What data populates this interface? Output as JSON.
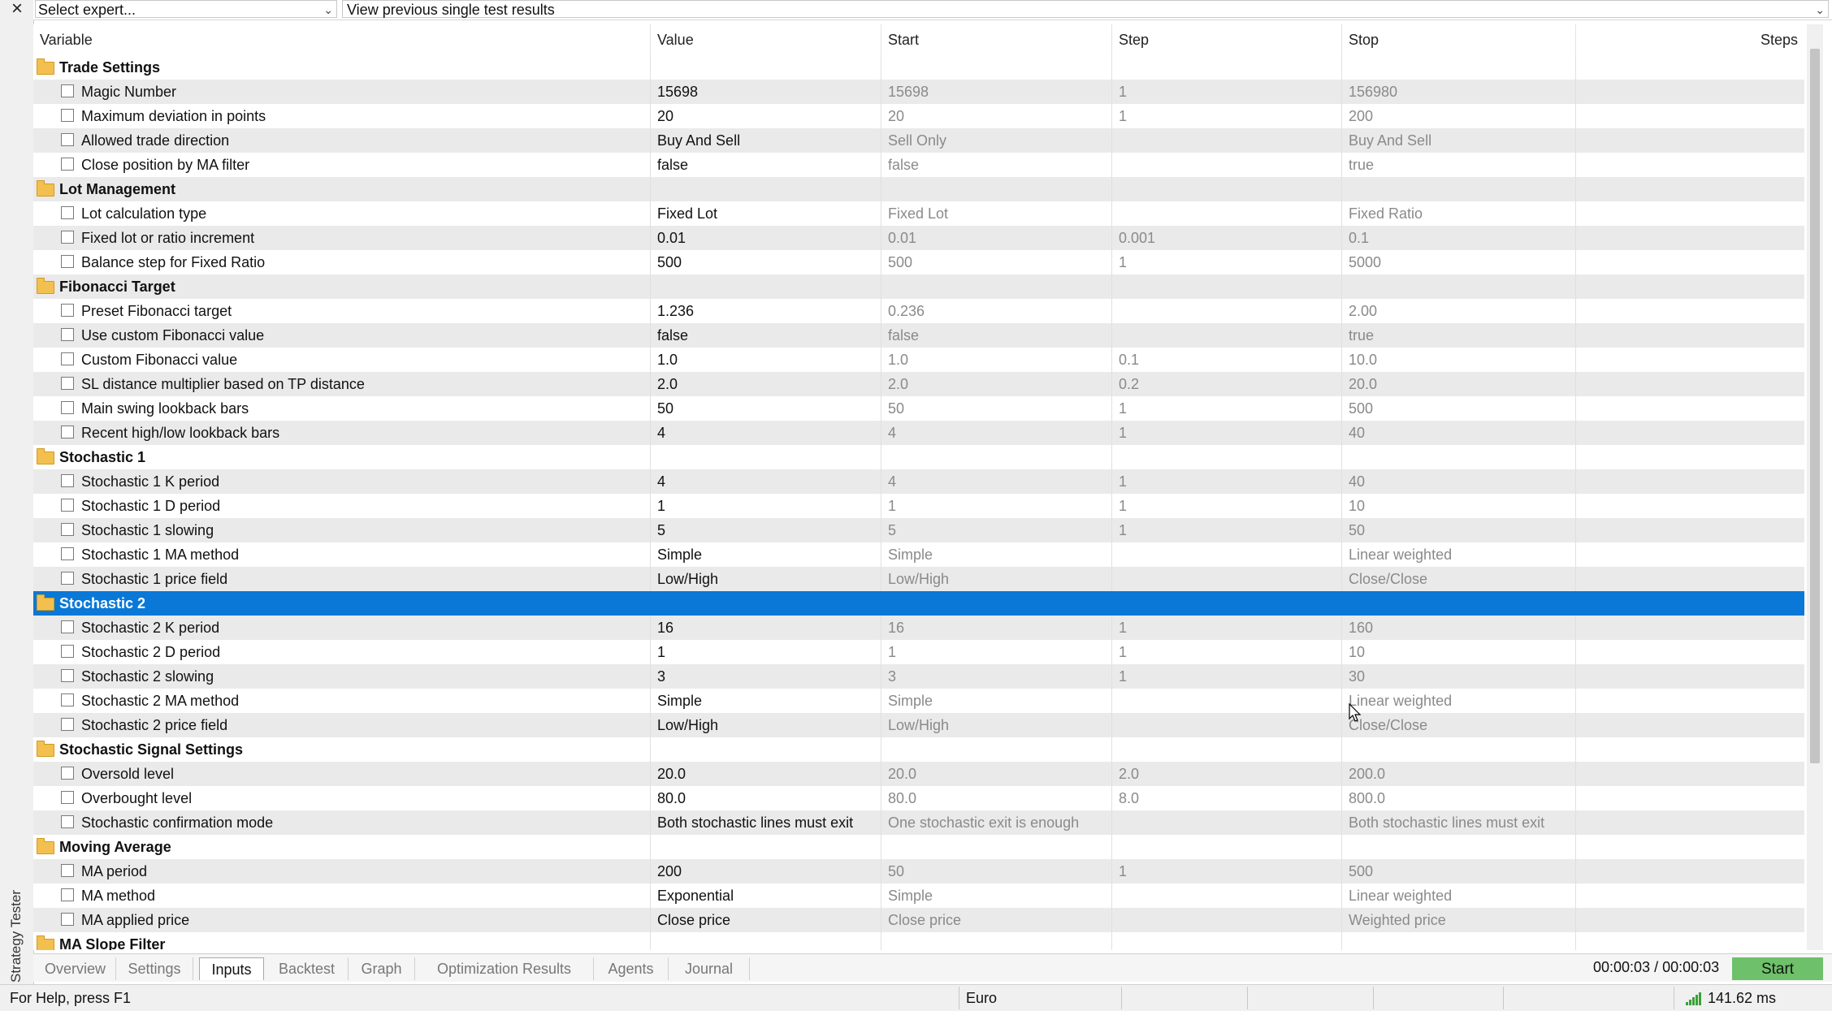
{
  "top": {
    "close_icon": "×",
    "expert_select": "Select expert...",
    "view_previous": "View previous single test results",
    "chevron": "⌄"
  },
  "side": {
    "label": "Strategy Tester"
  },
  "header": {
    "variable": "Variable",
    "value": "Value",
    "start": "Start",
    "step": "Step",
    "stop": "Stop",
    "steps": "Steps"
  },
  "rows": [
    {
      "type": "group",
      "name": "Trade Settings"
    },
    {
      "type": "param",
      "name": "Magic Number",
      "value": "15698",
      "start": "15698",
      "step": "1",
      "stop": "156980"
    },
    {
      "type": "param",
      "name": "Maximum deviation in points",
      "value": "20",
      "start": "20",
      "step": "1",
      "stop": "200"
    },
    {
      "type": "param",
      "name": "Allowed trade direction",
      "value": "Buy And Sell",
      "start": "Sell Only",
      "step": "",
      "stop": "Buy And Sell"
    },
    {
      "type": "param",
      "name": "Close position by MA filter",
      "value": "false",
      "start": "false",
      "step": "",
      "stop": "true"
    },
    {
      "type": "group",
      "name": "Lot Management"
    },
    {
      "type": "param",
      "name": "Lot calculation type",
      "value": "Fixed Lot",
      "start": "Fixed Lot",
      "step": "",
      "stop": "Fixed Ratio"
    },
    {
      "type": "param",
      "name": "Fixed lot or ratio increment",
      "value": "0.01",
      "start": "0.01",
      "step": "0.001",
      "stop": "0.1"
    },
    {
      "type": "param",
      "name": "Balance step for Fixed Ratio",
      "value": "500",
      "start": "500",
      "step": "1",
      "stop": "5000"
    },
    {
      "type": "group",
      "name": "Fibonacci Target"
    },
    {
      "type": "param",
      "name": "Preset Fibonacci target",
      "value": "1.236",
      "start": "0.236",
      "step": "",
      "stop": "2.00"
    },
    {
      "type": "param",
      "name": "Use custom Fibonacci value",
      "value": "false",
      "start": "false",
      "step": "",
      "stop": "true"
    },
    {
      "type": "param",
      "name": "Custom Fibonacci value",
      "value": "1.0",
      "start": "1.0",
      "step": "0.1",
      "stop": "10.0"
    },
    {
      "type": "param",
      "name": "SL distance multiplier based on TP distance",
      "value": "2.0",
      "start": "2.0",
      "step": "0.2",
      "stop": "20.0"
    },
    {
      "type": "param",
      "name": "Main swing lookback bars",
      "value": "50",
      "start": "50",
      "step": "1",
      "stop": "500"
    },
    {
      "type": "param",
      "name": "Recent high/low lookback bars",
      "value": "4",
      "start": "4",
      "step": "1",
      "stop": "40"
    },
    {
      "type": "group",
      "name": "Stochastic 1"
    },
    {
      "type": "param",
      "name": "Stochastic 1 K period",
      "value": "4",
      "start": "4",
      "step": "1",
      "stop": "40"
    },
    {
      "type": "param",
      "name": "Stochastic 1 D period",
      "value": "1",
      "start": "1",
      "step": "1",
      "stop": "10"
    },
    {
      "type": "param",
      "name": "Stochastic 1 slowing",
      "value": "5",
      "start": "5",
      "step": "1",
      "stop": "50"
    },
    {
      "type": "param",
      "name": "Stochastic 1 MA method",
      "value": "Simple",
      "start": "Simple",
      "step": "",
      "stop": "Linear weighted"
    },
    {
      "type": "param",
      "name": "Stochastic 1 price field",
      "value": "Low/High",
      "start": "Low/High",
      "step": "",
      "stop": "Close/Close"
    },
    {
      "type": "group",
      "name": "Stochastic 2",
      "selected": true
    },
    {
      "type": "param",
      "name": "Stochastic 2 K period",
      "value": "16",
      "start": "16",
      "step": "1",
      "stop": "160"
    },
    {
      "type": "param",
      "name": "Stochastic 2 D period",
      "value": "1",
      "start": "1",
      "step": "1",
      "stop": "10"
    },
    {
      "type": "param",
      "name": "Stochastic 2 slowing",
      "value": "3",
      "start": "3",
      "step": "1",
      "stop": "30"
    },
    {
      "type": "param",
      "name": "Stochastic 2 MA method",
      "value": "Simple",
      "start": "Simple",
      "step": "",
      "stop": "Linear weighted"
    },
    {
      "type": "param",
      "name": "Stochastic 2 price field",
      "value": "Low/High",
      "start": "Low/High",
      "step": "",
      "stop": "Close/Close"
    },
    {
      "type": "group",
      "name": "Stochastic Signal Settings"
    },
    {
      "type": "param",
      "name": "Oversold level",
      "value": "20.0",
      "start": "20.0",
      "step": "2.0",
      "stop": "200.0"
    },
    {
      "type": "param",
      "name": "Overbought level",
      "value": "80.0",
      "start": "80.0",
      "step": "8.0",
      "stop": "800.0"
    },
    {
      "type": "param",
      "name": "Stochastic confirmation mode",
      "value": "Both stochastic lines must exit",
      "start": "One stochastic exit is enough",
      "step": "",
      "stop": "Both stochastic lines must exit"
    },
    {
      "type": "group",
      "name": "Moving Average"
    },
    {
      "type": "param",
      "name": "MA period",
      "value": "200",
      "start": "50",
      "step": "1",
      "stop": "500"
    },
    {
      "type": "param",
      "name": "MA method",
      "value": "Exponential",
      "start": "Simple",
      "step": "",
      "stop": "Linear weighted"
    },
    {
      "type": "param",
      "name": "MA applied price",
      "value": "Close price",
      "start": "Close price",
      "step": "",
      "stop": "Weighted price"
    },
    {
      "type": "group",
      "name": "MA Slope Filter"
    }
  ],
  "tabs": [
    {
      "label": "Overview"
    },
    {
      "label": "Settings"
    },
    {
      "label": "Inputs",
      "active": true
    },
    {
      "label": "Backtest"
    },
    {
      "label": "Graph"
    },
    {
      "label": "Optimization Results"
    },
    {
      "label": "Agents"
    },
    {
      "label": "Journal"
    }
  ],
  "footer": {
    "timer": "00:00:03 / 00:00:03",
    "start_label": "Start"
  },
  "status": {
    "help": "For Help, press F1",
    "currency": "Euro",
    "ping": "141.62 ms"
  },
  "colors": {
    "selection": "#0a78d7",
    "folder": "#f3c04f",
    "start_button": "#6fc06a",
    "signal": "#3aa13a"
  }
}
